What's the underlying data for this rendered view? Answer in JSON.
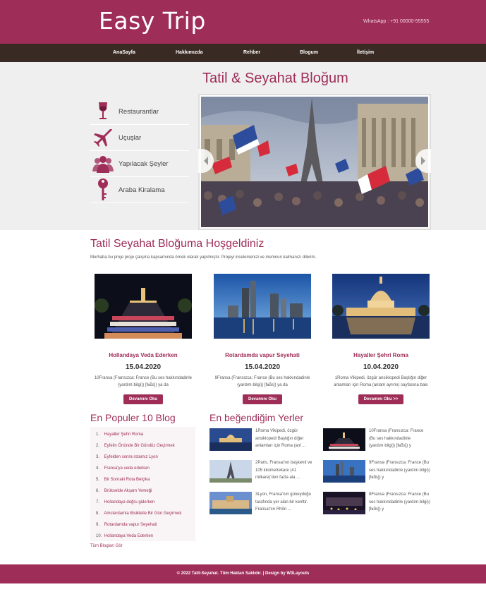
{
  "header": {
    "logo": "Easy Trip",
    "whatsapp": "WhatsApp : +91 00000-55555"
  },
  "nav": {
    "items": [
      "AnaSayfa",
      "Hakkımızda",
      "Rehber",
      "Blogum",
      "İletişim"
    ]
  },
  "hero": {
    "title": "Tatil & Seyahat Bloğum",
    "menu": [
      {
        "label": "Restaurantlar",
        "icon": "wine-glass-icon"
      },
      {
        "label": "Uçuşlar",
        "icon": "airplane-icon"
      },
      {
        "label": "Yapılacak Şeyler",
        "icon": "people-icon"
      },
      {
        "label": "Araba Kiralama",
        "icon": "key-icon"
      }
    ]
  },
  "welcome": {
    "title": "Tatil Seyahat Bloğuma Hoşgeldiniz",
    "text": "Merhaba bu proje proje çalışma kapsamında örnek olarak yapılmıştır. Projeyi incelemenizi ve memnun kalmanızı dilerim."
  },
  "cards": [
    {
      "title": "Hollandaya Veda Ederken",
      "date": "15.04.2020",
      "excerpt": "10Fransa (Fransızca: France (Bu ses hakkındadinle (yardım·bilgi)) [fʁɑ̃s]) ya da",
      "button": "Devamını Oku"
    },
    {
      "title": "Rotardamda vapur Seyehati",
      "date": "15.04.2020",
      "excerpt": "9Fransa (Fransızca: France (Bu ses hakkındadinle (yardım·bilgi)) [fʁɑ̃s]) ya da",
      "button": "Devamını Oku"
    },
    {
      "title": "Hayaller Şehri Roma",
      "date": "10.04.2020",
      "excerpt": "1Roma Vikipedi, özgür ansiklopedi Başlığın diğer anlamları için Roma (anlam ayrımı) sayfasına bakı",
      "button": "Devamını Oku >>"
    }
  ],
  "popular": {
    "title": "En Populer 10 Blog",
    "items": [
      "Hayaller Şehri Roma",
      "Eyfelin Önünde Bir Gündüz Geçirmek",
      "Eyfelden sonra rotamız Lyon",
      "Fransa'ya veda ederken",
      "Bir Sonraki Rota Belçika",
      "Brükselde Akşam Yemeği",
      "Hollandaya doğru giderken",
      "Amsterdamla Bisikletle Bir Gün Geçirmek",
      "Rotardamda vapur Seyehati",
      "Hollandaya Veda Ederken"
    ],
    "all_link": "Tüm Blogları Gör"
  },
  "favorites": {
    "title": "En beğendiğim Yerler",
    "items": [
      {
        "text": "1Roma Vikipedi, özgür ansiklopedi Başlığın diğer anlamları için Roma (anl ..."
      },
      {
        "text": "10Fransa (Fransızca: France (Bu ses hakkındadinle (yardım·bilgi)) [fʁɑ̃s]) y"
      },
      {
        "text": "2Paris, Fransa'nın başkenti ve 105 kilometrekare (41 milkare)'den fazla ala ..."
      },
      {
        "text": "9Fransa (Fransızca: France (Bu ses hakkındadinle (yardım·bilgi)) [fʁɑ̃s]) y"
      },
      {
        "text": "3Lyon, Fransa'nın güneydoğu tarafında yer alan bir kenttir. Fransa'nın Rhôn ..."
      },
      {
        "text": "8Fransa (Fransızca: France (Bu ses hakkındadinle (yardım·bilgi)) [fʁɑ̃s]) y"
      }
    ]
  },
  "footer": {
    "text": "© 2022 Tatil-Seyahat. Tüm Hakları Saklıdır. | Design by W3Layouts"
  },
  "colors": {
    "brand": "#9e2d57",
    "nav": "#3a2a24",
    "hero_bg": "#efefef"
  }
}
